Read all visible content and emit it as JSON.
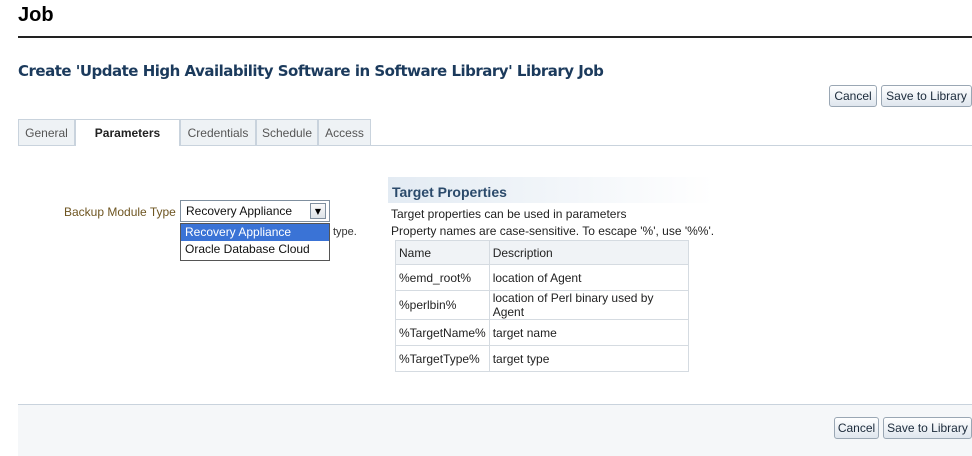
{
  "page": {
    "title": "Job"
  },
  "job": {
    "title": "Create 'Update High Availability Software in Software Library' Library Job"
  },
  "buttons": {
    "cancel": "Cancel",
    "save": "Save to Library"
  },
  "tabs": [
    {
      "label": "General",
      "active": false
    },
    {
      "label": "Parameters",
      "active": true
    },
    {
      "label": "Credentials",
      "active": false
    },
    {
      "label": "Schedule",
      "active": false
    },
    {
      "label": "Access",
      "active": false
    }
  ],
  "backup": {
    "label": "Backup Module Type",
    "value": "Recovery Appliance",
    "options": [
      "Recovery Appliance",
      "Oracle Database Cloud"
    ],
    "hint_tail": "type."
  },
  "target_properties": {
    "title": "Target Properties",
    "desc1": "Target properties can be used in parameters",
    "desc2": "Property names are case-sensitive. To escape '%', use '%%'.",
    "columns": [
      "Name",
      "Description"
    ],
    "rows": [
      [
        "%emd_root%",
        "location of Agent"
      ],
      [
        "%perlbin%",
        "location of Perl binary used by Agent"
      ],
      [
        "%TargetName%",
        "target name"
      ],
      [
        "%TargetType%",
        "target type"
      ]
    ]
  },
  "colors": {
    "accent": "#3a73d6",
    "label": "#6e5521",
    "title": "#1b3a5c"
  },
  "icons": {
    "select_arrow": "chevron-down-icon"
  }
}
